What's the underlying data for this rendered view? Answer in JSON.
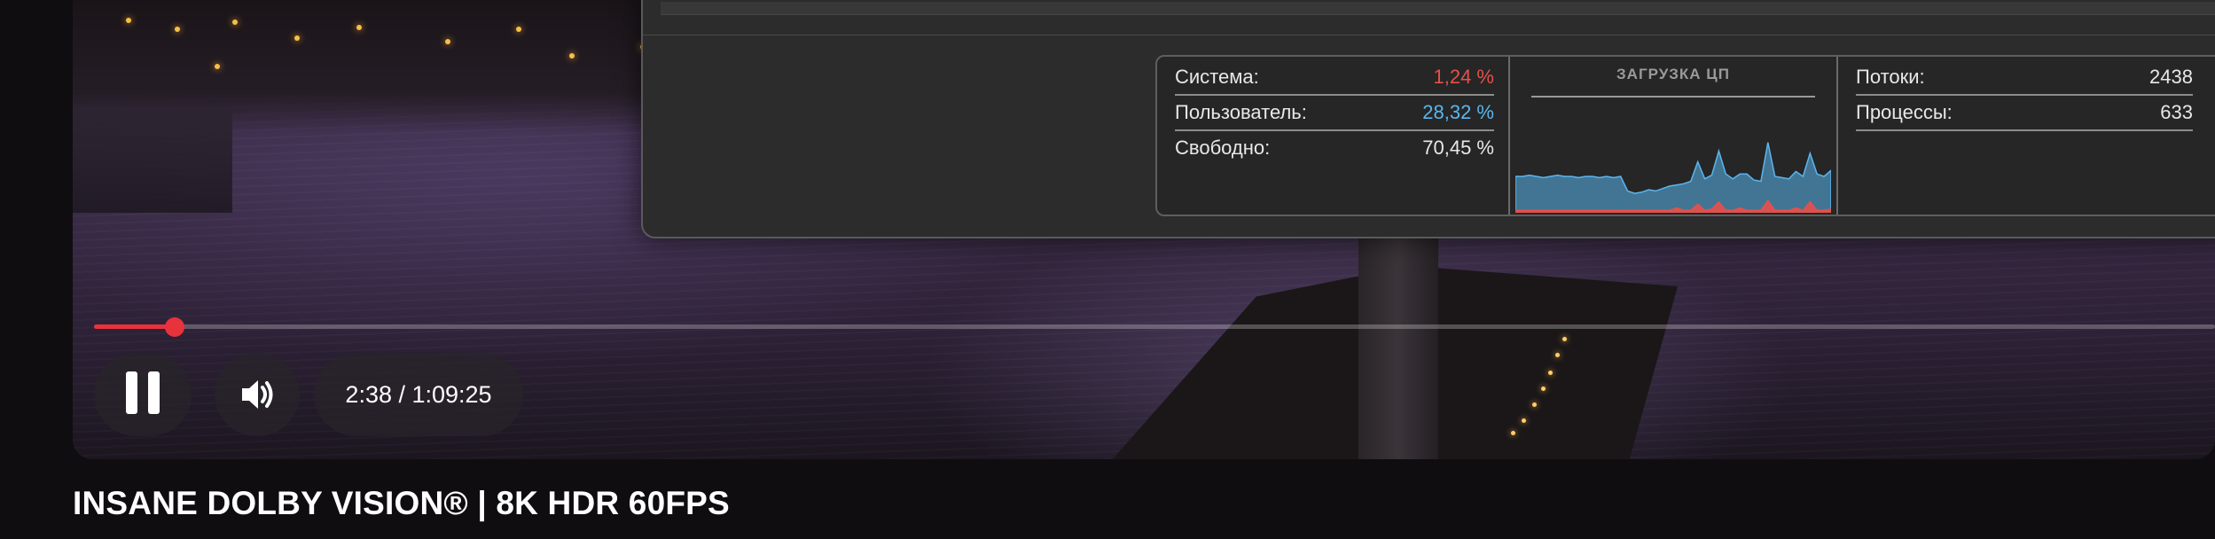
{
  "video": {
    "title": "INSANE DOLBY VISION® | 8K HDR 60FPS",
    "time": "2:38 / 1:09:25",
    "progress_fraction": 0.038
  },
  "activity_monitor": {
    "stats": [
      {
        "label": "Система:",
        "value": "1,24 %",
        "color": "#e8504a"
      },
      {
        "label": "Пользователь:",
        "value": "28,32 %",
        "color": "#5ab6ef"
      },
      {
        "label": "Свободно:",
        "value": "70,45 %",
        "color": "#e8e8e8"
      }
    ],
    "graph_title": "ЗАГРУЗКА ЦП",
    "counts": [
      {
        "label": "Потоки:",
        "value": "2438"
      },
      {
        "label": "Процессы:",
        "value": "633"
      }
    ],
    "cpu_history": {
      "user": [
        28,
        28,
        29,
        28,
        27,
        28,
        29,
        28,
        28,
        27,
        28,
        28,
        27,
        28,
        27,
        28,
        16,
        14,
        15,
        17,
        16,
        18,
        20,
        19,
        22,
        24,
        35,
        26,
        28,
        42,
        30,
        26,
        28,
        30,
        25,
        24,
        48,
        28,
        27,
        26,
        30,
        28,
        40,
        30,
        28,
        32
      ],
      "system": [
        2,
        2,
        2,
        2,
        2,
        2,
        2,
        2,
        2,
        2,
        2,
        2,
        2,
        2,
        2,
        2,
        2,
        2,
        2,
        2,
        2,
        2,
        2,
        4,
        2,
        2,
        7,
        2,
        3,
        9,
        2,
        2,
        4,
        2,
        2,
        2,
        10,
        2,
        2,
        2,
        4,
        2,
        9,
        2,
        2,
        3
      ]
    },
    "colors": {
      "user": "#5ab6ef",
      "system": "#e8504a"
    }
  },
  "colors": {
    "accent": "#e8323c"
  }
}
